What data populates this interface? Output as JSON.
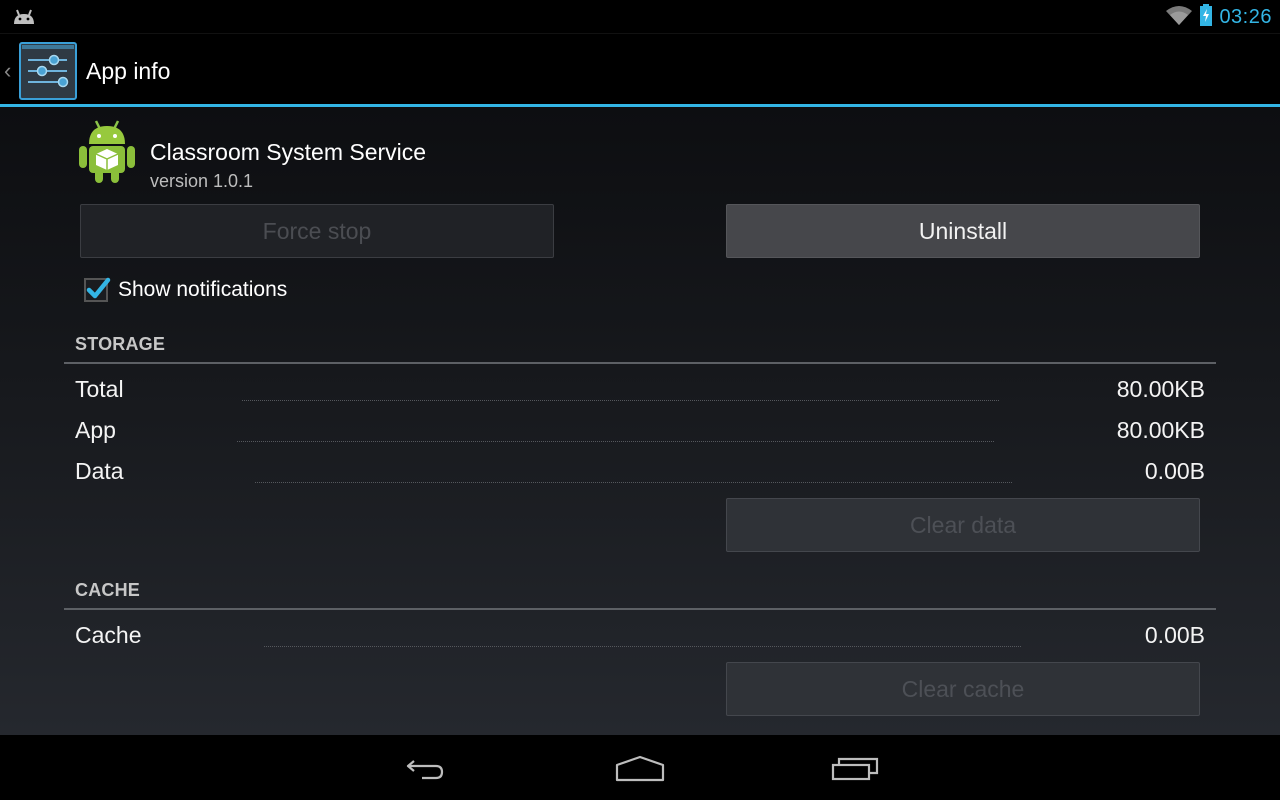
{
  "status_bar": {
    "clock": "03:26",
    "icons": [
      "android-notification-icon",
      "wifi-icon",
      "battery-charging-icon"
    ],
    "accent_color": "#33b5e5"
  },
  "action_bar": {
    "title": "App info",
    "icon": "settings-sliders-icon"
  },
  "app": {
    "name": "Classroom System Service",
    "version": "version 1.0.1",
    "icon": "android-app-icon"
  },
  "buttons": {
    "force_stop": "Force stop",
    "uninstall": "Uninstall",
    "clear_data": "Clear data",
    "clear_cache": "Clear cache"
  },
  "show_notifications": {
    "label": "Show notifications",
    "checked": true
  },
  "storage": {
    "header": "STORAGE",
    "rows": [
      {
        "label": "Total",
        "value": "80.00KB"
      },
      {
        "label": "App",
        "value": "80.00KB"
      },
      {
        "label": "Data",
        "value": "0.00B"
      }
    ]
  },
  "cache": {
    "header": "CACHE",
    "rows": [
      {
        "label": "Cache",
        "value": "0.00B"
      }
    ]
  },
  "nav_bar": {
    "buttons": [
      "back-icon",
      "home-icon",
      "recent-apps-icon"
    ]
  }
}
